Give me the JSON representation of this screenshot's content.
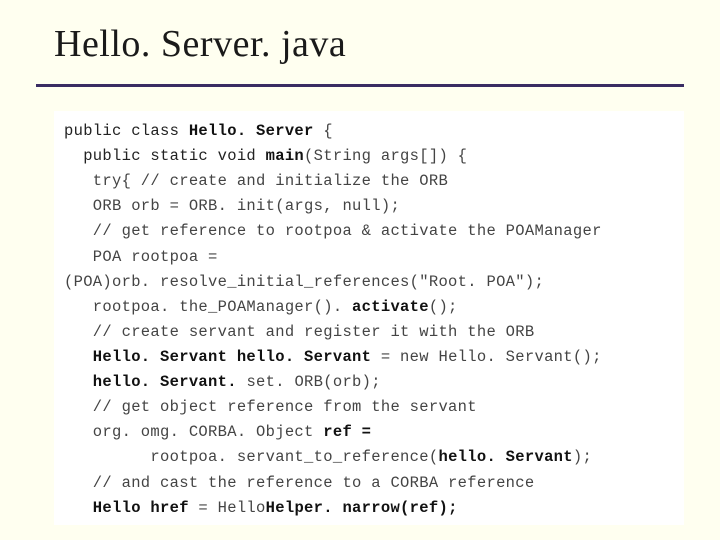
{
  "title": "Hello. Server. java",
  "code": {
    "l1a": "public class",
    "l1b": " Hello. Server ",
    "l1c": "{",
    "l2a": "  public static void",
    "l2b": " main",
    "l2c": "(String args[]) {",
    "l3": "   try{ // create and initialize the ORB",
    "l4": "   ORB orb = ORB. init(args, null);",
    "l5": "   // get reference to rootpoa & activate the POAManager",
    "l6": "   POA rootpoa =",
    "l7": "(POA)orb. resolve_initial_references(\"Root. POA\");",
    "l8a": "   rootpoa. the_POAManager(). ",
    "l8b": "activate",
    "l8c": "();",
    "l9": "   // create servant and register it with the ORB",
    "l10a": "   Hello. Servant hello. Servant ",
    "l10b": "= new Hello. Servant();",
    "l11a": "   hello. Servant. ",
    "l11b": "set. ORB(orb);",
    "l12": "   // get object reference from the servant",
    "l13a": "   org. omg. CORBA. Object",
    "l13b": " ref =",
    "l14a": "         rootpoa. servant_to_reference(",
    "l14b": "hello. Servant",
    "l14c": ");",
    "l15": "   // and cast the reference to a CORBA reference",
    "l16a": "   Hello href ",
    "l16b": "= Hello",
    "l16c": "Helper. narrow(ref);"
  }
}
